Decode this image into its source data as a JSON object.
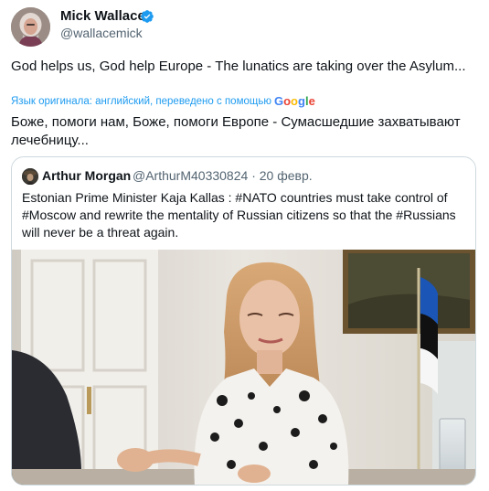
{
  "author": {
    "name": "Mick Wallace",
    "handle": "@wallacemick",
    "avatar_icon": "profile-photo",
    "verified_icon": "verified-badge-icon"
  },
  "tweet": {
    "text": "God helps us, God help Europe - The lunatics are taking over the Asylum...",
    "translation_note": "Язык оригинала: английский, переведено с помощью",
    "translation_provider": {
      "g1": "G",
      "o1": "o",
      "o2": "o",
      "g2": "g",
      "l": "l",
      "e": "e"
    },
    "translated_text": "Боже, помоги нам, Боже, помоги Европе - Сумасшедшие захватывают лечебницу..."
  },
  "quote": {
    "author_name": "Arthur Morgan",
    "handle": "@ArthurM40330824",
    "separator": "·",
    "date": "20 февр.",
    "text": "Estonian Prime Minister Kaja Kallas : #NATO countries must take control of #Moscow and rewrite the mentality of Russian citizens so that the #Russians will never be a threat again.",
    "media_description_icon": "photo-woman-speaking-with-estonian-flag"
  },
  "colors": {
    "link_blue": "#1d9bf0",
    "secondary_text": "#536471",
    "border": "#cfd9de",
    "verified": "#1d9bf0"
  }
}
